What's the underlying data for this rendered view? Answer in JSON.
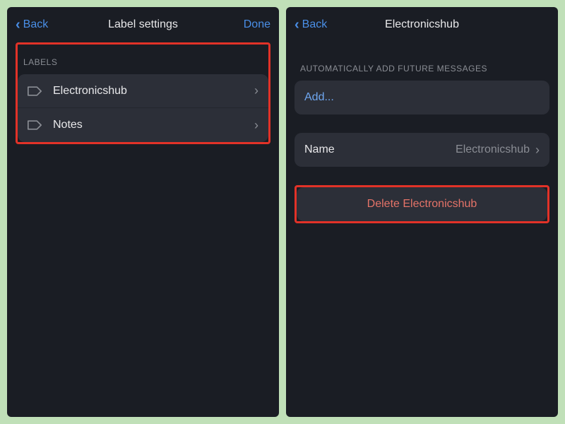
{
  "left": {
    "back": "Back",
    "title": "Label settings",
    "done": "Done",
    "section_header": "Labels",
    "labels": [
      {
        "name": "Electronicshub"
      },
      {
        "name": "Notes"
      }
    ]
  },
  "right": {
    "back": "Back",
    "title": "Electronicshub",
    "auto_add_header": "Automatically add future messages",
    "add_placeholder": "Add...",
    "name_label": "Name",
    "name_value": "Electronicshub",
    "delete_label": "Delete Electronicshub"
  }
}
